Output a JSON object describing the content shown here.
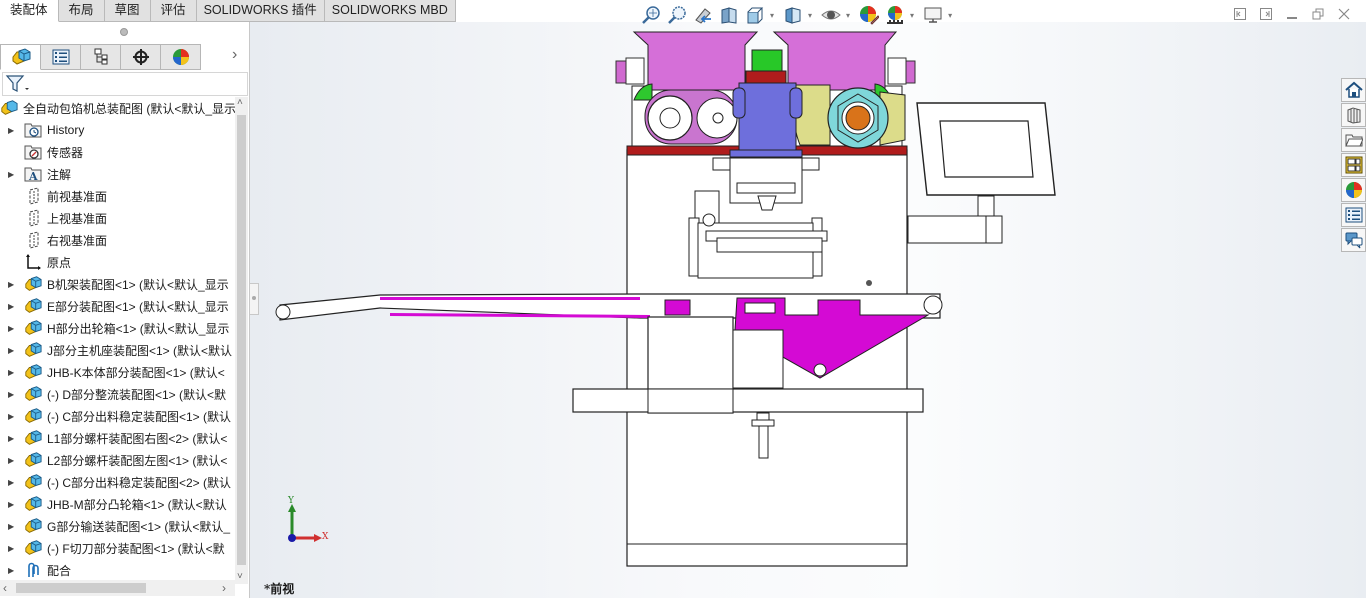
{
  "command_tabs": [
    {
      "label": "装配体",
      "active": true
    },
    {
      "label": "布局",
      "active": false
    },
    {
      "label": "草图",
      "active": false
    },
    {
      "label": "评估",
      "active": false
    },
    {
      "label": "SOLIDWORKS 插件",
      "active": false
    },
    {
      "label": "SOLIDWORKS MBD",
      "active": false
    }
  ],
  "panel_tabs": [
    {
      "name": "featuremanager-tab",
      "icon": "assembly-icon"
    },
    {
      "name": "propertymanager-tab",
      "icon": "property-list-icon"
    },
    {
      "name": "configurationmanager-tab",
      "icon": "configuration-icon"
    },
    {
      "name": "dimxpertmanager-tab",
      "icon": "crosshair-icon"
    },
    {
      "name": "displaymanager-tab",
      "icon": "appearance-sphere-icon"
    }
  ],
  "tree": {
    "root": "全自动包馅机总装配图  (默认<默认_显示",
    "items": [
      {
        "label": "History",
        "icon": "history-folder-icon",
        "expandable": true
      },
      {
        "label": "传感器",
        "icon": "sensor-folder-icon",
        "expandable": false
      },
      {
        "label": "注解",
        "icon": "annotation-folder-icon",
        "expandable": true
      },
      {
        "label": "前视基准面",
        "icon": "plane-icon",
        "expandable": false
      },
      {
        "label": "上视基准面",
        "icon": "plane-icon",
        "expandable": false
      },
      {
        "label": "右视基准面",
        "icon": "plane-icon",
        "expandable": false
      },
      {
        "label": "原点",
        "icon": "origin-icon",
        "expandable": false
      },
      {
        "label": "B机架装配图<1> (默认<默认_显示",
        "icon": "subassembly-icon",
        "expandable": true
      },
      {
        "label": "E部分装配图<1> (默认<默认_显示",
        "icon": "subassembly-icon",
        "expandable": true
      },
      {
        "label": "H部分出轮箱<1> (默认<默认_显示",
        "icon": "subassembly-icon",
        "expandable": true
      },
      {
        "label": "J部分主机座装配图<1> (默认<默认",
        "icon": "subassembly-icon",
        "expandable": true
      },
      {
        "label": "JHB-K本体部分装配图<1> (默认<",
        "icon": "subassembly-icon",
        "expandable": true
      },
      {
        "label": "(-) D部分整流装配图<1> (默认<默",
        "icon": "subassembly-icon",
        "expandable": true
      },
      {
        "label": "(-) C部分出料稳定装配图<1> (默认",
        "icon": "subassembly-icon",
        "expandable": true
      },
      {
        "label": "L1部分螺杆装配图右图<2> (默认<",
        "icon": "subassembly-icon",
        "expandable": true
      },
      {
        "label": "L2部分螺杆装配图左图<1> (默认<",
        "icon": "subassembly-icon",
        "expandable": true
      },
      {
        "label": "(-) C部分出料稳定装配图<2> (默认",
        "icon": "subassembly-icon",
        "expandable": true
      },
      {
        "label": "JHB-M部分凸轮箱<1> (默认<默认",
        "icon": "subassembly-icon",
        "expandable": true
      },
      {
        "label": "G部分输送装配图<1> (默认<默认_",
        "icon": "subassembly-icon",
        "expandable": true
      },
      {
        "label": "(-) F切刀部分装配图<1> (默认<默",
        "icon": "subassembly-icon",
        "expandable": true
      },
      {
        "label": "配合",
        "icon": "mates-icon",
        "expandable": true
      }
    ]
  },
  "heads_up_toolbar": [
    {
      "name": "zoom-to-fit-button",
      "icon": "zoom-to-fit-icon",
      "dropdown": false
    },
    {
      "name": "zoom-to-area-button",
      "icon": "zoom-to-area-icon",
      "dropdown": false
    },
    {
      "name": "previous-view-button",
      "icon": "previous-view-icon",
      "dropdown": false
    },
    {
      "name": "section-view-button",
      "icon": "section-view-icon",
      "dropdown": false
    },
    {
      "name": "view-orientation-button",
      "icon": "view-orientation-icon",
      "dropdown": true
    },
    {
      "name": "display-style-button",
      "icon": "display-style-icon",
      "dropdown": true
    },
    {
      "name": "hide-show-items-button",
      "icon": "eye-icon",
      "dropdown": true
    },
    {
      "name": "edit-appearance-button",
      "icon": "edit-appearance-icon",
      "dropdown": false
    },
    {
      "name": "apply-scene-button",
      "icon": "scene-icon",
      "dropdown": true
    },
    {
      "name": "view-settings-button",
      "icon": "monitor-icon",
      "dropdown": true
    }
  ],
  "task_pane": [
    {
      "name": "solidworks-resources-tab",
      "icon": "home-icon"
    },
    {
      "name": "design-library-tab",
      "icon": "library-books-icon"
    },
    {
      "name": "file-explorer-tab",
      "icon": "folder-icon"
    },
    {
      "name": "view-palette-tab",
      "icon": "view-palette-icon"
    },
    {
      "name": "appearances-tab",
      "icon": "appearance-sphere-icon"
    },
    {
      "name": "custom-properties-tab",
      "icon": "property-list-icon"
    },
    {
      "name": "forum-tab",
      "icon": "chat-bubbles-icon"
    }
  ],
  "triad": {
    "x_label": "X",
    "y_label": "Y"
  },
  "view_name": "*前视",
  "colors": {
    "hopper": "#d56fd8",
    "funnel_body": "#6e6fdc",
    "cyan_gear": "#7fd7da",
    "orange_core": "#d9731a",
    "yellow_part": "#dcdc8a",
    "green_part": "#28c828",
    "red_plate": "#b01c1c",
    "magenta_plate": "#d40ad4"
  }
}
